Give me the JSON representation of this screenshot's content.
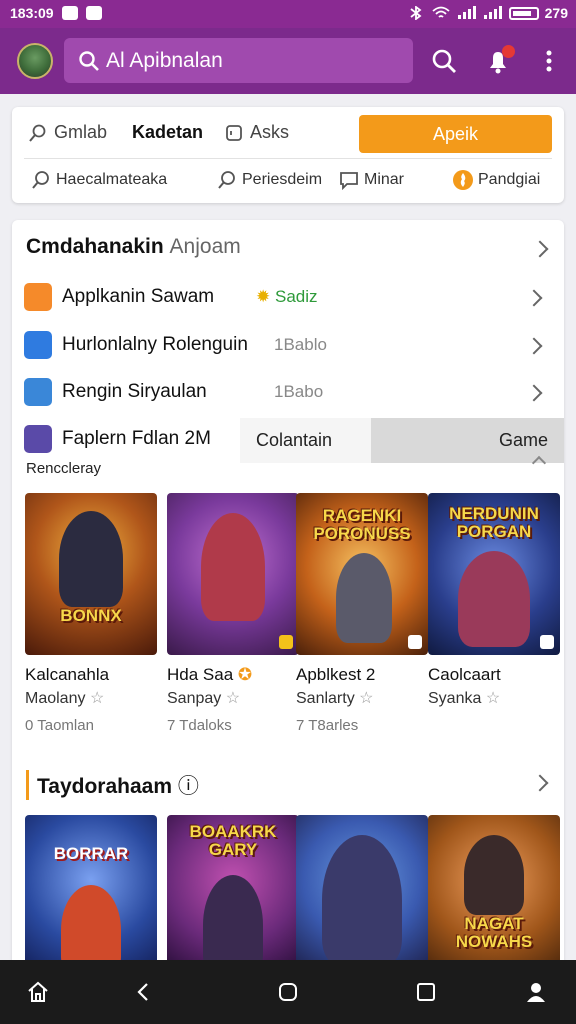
{
  "status_bar": {
    "time": "183:09",
    "battery": "279"
  },
  "app_bar": {
    "search_placeholder": "Al Apibnalan"
  },
  "tabs": [
    {
      "label": "Gmlab"
    },
    {
      "label": "Kadetan"
    },
    {
      "label": "Asks"
    }
  ],
  "apply_button": "Apeik",
  "chips": [
    {
      "label": "Haecalmateaka"
    },
    {
      "label": "Periesdeim"
    },
    {
      "label": "Minar"
    },
    {
      "label": "Pandgiai"
    }
  ],
  "section1": {
    "title": "Cmdahanakin",
    "subtitle": "Anjoam"
  },
  "rows": [
    {
      "label": "Applkanin Sawam",
      "value": "Sadiz",
      "icon_color": "#f58a2a",
      "value_style": "green"
    },
    {
      "label": "Hurlonlalny Rolenguin",
      "value": "1Bablo",
      "icon_color": "#2f7be0"
    },
    {
      "label": "Rengin Siryaulan",
      "value": "1Babo",
      "icon_color": "#3a87d8"
    },
    {
      "label": "Faplern Fdlan 2M",
      "icon_color": "#5a4aa8"
    }
  ],
  "segment": {
    "left": "Colantain",
    "right": "Game"
  },
  "recent_label": "Renccleray",
  "games": [
    {
      "name": "Kalcanahla",
      "sub": "Maolany",
      "size": "0 Taomlan",
      "title_art": "BONNX",
      "bg": "#9c4a1a",
      "fg": "#2b2b40"
    },
    {
      "name": "Hda Saa",
      "sub": "Sanpay",
      "size": "7 Tdaloks",
      "title_art": "",
      "bg": "#7a3a9c",
      "fg": "#b03a4a"
    },
    {
      "name": "Apblkest 2",
      "sub": "Sanlarty",
      "size": "7 T8arles",
      "title_art": "RAGENKI PORONUSS",
      "bg": "#c4621a",
      "fg": "#5a5a6a"
    },
    {
      "name": "Caolcaart",
      "sub": "Syanka",
      "size": "",
      "title_art": "NERDUNIN PORGAN",
      "bg": "#2a3e8c",
      "fg": "#9a3a5a"
    }
  ],
  "section2": {
    "title": "Taydorahaam"
  },
  "games2": [
    {
      "title_art": "BORRAR",
      "bg": "#2a4aa0"
    },
    {
      "title_art": "BOAAKRK GARY",
      "bg": "#6a2a7a"
    },
    {
      "title_art": "",
      "bg": "#3a5ab0"
    },
    {
      "title_art": "NAGAT NOWAHS",
      "bg": "#a0561a"
    }
  ]
}
